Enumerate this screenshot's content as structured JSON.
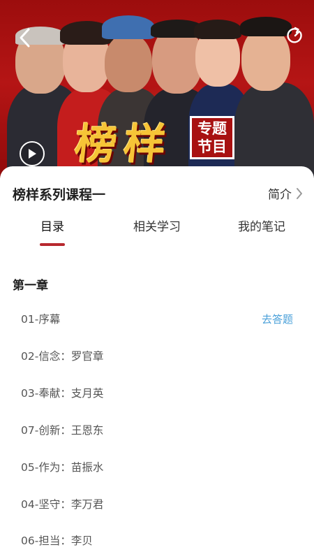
{
  "hero": {
    "title": "榜样",
    "badge_line1": "专题",
    "badge_line2": "节目",
    "icons": {
      "back": "chevron-left-icon",
      "share": "share-icon",
      "play": "play-icon"
    }
  },
  "course": {
    "title": "榜样系列课程一",
    "intro_label": "简介"
  },
  "tabs": [
    {
      "label": "目录",
      "active": true
    },
    {
      "label": "相关学习",
      "active": false
    },
    {
      "label": "我的笔记",
      "active": false
    }
  ],
  "chapter": {
    "title": "第一章",
    "lessons": [
      {
        "label": "01-序幕",
        "action": "去答题"
      },
      {
        "label": "02-信念：罗官章",
        "action": ""
      },
      {
        "label": "03-奉献：支月英",
        "action": ""
      },
      {
        "label": "07-创新：王恩东",
        "action": ""
      },
      {
        "label": "05-作为：苗振水",
        "action": ""
      },
      {
        "label": "04-坚守：李万君",
        "action": ""
      },
      {
        "label": "06-担当：李贝",
        "action": ""
      }
    ]
  },
  "colors": {
    "accent": "#b7282e",
    "link": "#4aa0d9",
    "hero_red": "#b51515",
    "title_gold": "#f6c437"
  }
}
